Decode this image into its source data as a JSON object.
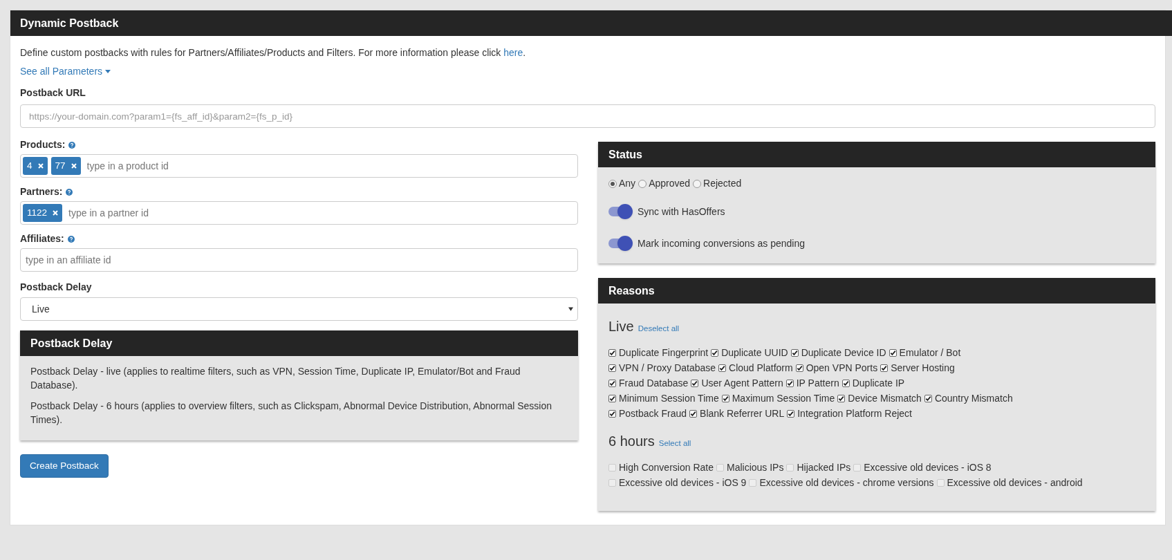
{
  "panel": {
    "title": "Dynamic Postback"
  },
  "intro": {
    "text": "Define custom postbacks with rules for Partners/Affiliates/Products and Filters. For more information please click ",
    "link": "here",
    "end": "."
  },
  "parameters_link": "See all Parameters",
  "postback_url": {
    "label": "Postback URL",
    "placeholder": "https://your-domain.com?param1={fs_aff_id}&param2={fs_p_id}"
  },
  "tag_fields": [
    {
      "label": "Products:",
      "tags": [
        "4",
        "77"
      ],
      "placeholder": "type in a product id"
    },
    {
      "label": "Partners:",
      "tags": [
        "1122"
      ],
      "placeholder": "type in a partner id"
    },
    {
      "label": "Affiliates:",
      "placeholder": "type in an affiliate id"
    }
  ],
  "delay_select": {
    "label": "Postback Delay",
    "value": "Live"
  },
  "delay_info": {
    "title": "Postback Delay",
    "paragraphs": [
      "Postback Delay - live (applies to realtime filters, such as VPN, Session Time, Duplicate IP, Emulator/Bot and Fraud Database).",
      "Postback Delay - 6 hours (applies to overview filters, such as Clickspam, Abnormal Device Distribution, Abnormal Session Times)."
    ]
  },
  "create_button": "Create Postback",
  "status": {
    "title": "Status",
    "radios": [
      {
        "label": "Any",
        "selected": true
      },
      {
        "label": "Approved",
        "selected": false
      },
      {
        "label": "Rejected",
        "selected": false
      }
    ],
    "toggles": [
      {
        "label": "Sync with HasOffers",
        "on": true
      },
      {
        "label": "Mark incoming conversions as pending",
        "on": true
      }
    ]
  },
  "reasons": {
    "title": "Reasons",
    "groups": [
      {
        "heading": "Live",
        "action": "Deselect all",
        "lines": [
          {
            "items": [
              {
                "label": "Duplicate Fingerprint",
                "checked": true
              },
              {
                "label": "Duplicate UUID",
                "checked": true
              },
              {
                "label": "Duplicate Device ID",
                "checked": true
              },
              {
                "label": "Emulator / Bot",
                "checked": true
              }
            ]
          },
          {
            "items": [
              {
                "label": "VPN / Proxy Database",
                "checked": true
              },
              {
                "label": "Cloud Platform",
                "checked": true
              },
              {
                "label": "Open VPN Ports",
                "checked": true
              },
              {
                "label": "Server Hosting",
                "checked": true
              }
            ]
          },
          {
            "items": [
              {
                "label": "Fraud Database",
                "checked": true
              },
              {
                "label": "User Agent Pattern",
                "checked": true
              },
              {
                "label": "IP Pattern",
                "checked": true
              },
              {
                "label": "Duplicate IP",
                "checked": true
              }
            ]
          },
          {
            "items": [
              {
                "label": "Minimum Session Time",
                "checked": true
              },
              {
                "label": "Maximum Session Time",
                "checked": true
              },
              {
                "label": "Device Mismatch",
                "checked": true
              },
              {
                "label": "Country Mismatch",
                "checked": true
              }
            ]
          },
          {
            "items": [
              {
                "label": "Postback Fraud",
                "checked": true
              },
              {
                "label": "Blank Referrer URL",
                "checked": true
              },
              {
                "label": "Integration Platform Reject",
                "checked": true
              }
            ]
          }
        ]
      },
      {
        "heading": "6 hours",
        "action": "Select all",
        "lines": [
          {
            "items": [
              {
                "label": "High Conversion Rate",
                "checked": false
              },
              {
                "label": "Malicious IPs",
                "checked": false
              },
              {
                "label": "Hijacked IPs",
                "checked": false
              },
              {
                "label": "Excessive old devices - iOS 8",
                "checked": false
              }
            ]
          },
          {
            "items": [
              {
                "label": "Excessive old devices - iOS 9",
                "checked": false
              },
              {
                "label": "Excessive old devices - chrome versions",
                "checked": false
              },
              {
                "label": "Excessive old devices - android",
                "checked": false
              }
            ]
          }
        ]
      }
    ]
  }
}
